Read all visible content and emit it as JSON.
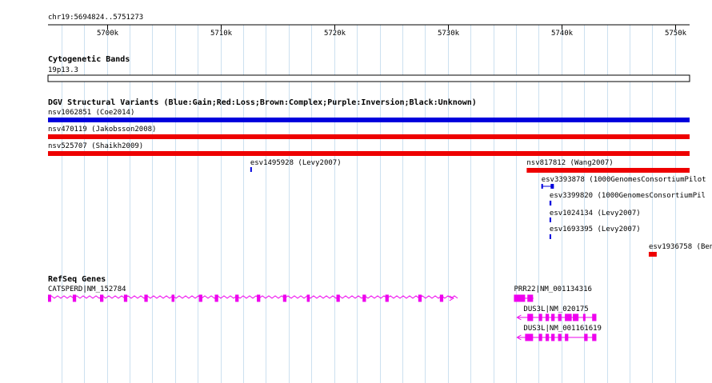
{
  "view": {
    "location": "chr19:5694824..5751273",
    "start": 5694824,
    "end": 5751273,
    "grid_color": "#cce0f0",
    "ticks": [
      {
        "pos": 5700000,
        "label": "5700k"
      },
      {
        "pos": 5710000,
        "label": "5710k"
      },
      {
        "pos": 5720000,
        "label": "5720k"
      },
      {
        "pos": 5730000,
        "label": "5730k"
      },
      {
        "pos": 5740000,
        "label": "5740k"
      },
      {
        "pos": 5750000,
        "label": "5750k"
      }
    ]
  },
  "tracks": {
    "cyto": {
      "title": "Cytogenetic Bands",
      "band": "19p13.3"
    },
    "dgv": {
      "title": "DGV Structural Variants (Blue:Gain;Red:Loss;Brown:Complex;Purple:Inversion;Black:Unknown)",
      "colors": {
        "gain": "#0000dd",
        "loss": "#ee0000"
      },
      "features": [
        {
          "label": "nsv1062851 (Coe2014)",
          "start": 5694824,
          "end": 5751273,
          "type": "gain"
        },
        {
          "label": "nsv470119 (Jakobsson2008)",
          "start": 5694824,
          "end": 5751273,
          "type": "loss"
        },
        {
          "label": "nsv525707 (Shaikh2009)",
          "start": 5694824,
          "end": 5751273,
          "type": "loss"
        },
        {
          "label": "esv1495928 (Levy2007)",
          "start": 5712620,
          "end": 5712700,
          "type": "gain"
        },
        {
          "label": "nsv817812 (Wang2007)",
          "start": 5736940,
          "end": 5751273,
          "type": "loss"
        },
        {
          "label": "esv3393878 (1000GenomesConsortiumPilot",
          "start": 5738230,
          "end": 5739330,
          "type": "gain"
        },
        {
          "label": "esv3399820 (1000GenomesConsortiumPil",
          "start": 5738950,
          "end": 5739110,
          "type": "gain"
        },
        {
          "label": "esv1024134 (Levy2007)",
          "start": 5738950,
          "end": 5739030,
          "type": "gain"
        },
        {
          "label": "esv1693395 (Levy2007)",
          "start": 5738950,
          "end": 5739030,
          "type": "gain"
        },
        {
          "label": "esv1936758 (Ben",
          "start": 5747680,
          "end": 5748380,
          "type": "loss"
        }
      ]
    },
    "refseq": {
      "title": "RefSeq Genes",
      "color": "#ee00ee",
      "genes": [
        {
          "label": "CATSPERD|NM_152784",
          "start": 5694824,
          "end": 5730500,
          "strand": "+",
          "exons": [
            [
              5694824,
              5695100
            ],
            [
              5697000,
              5697300
            ],
            [
              5699400,
              5699700
            ],
            [
              5701500,
              5701800
            ],
            [
              5703300,
              5703600
            ],
            [
              5705700,
              5705950
            ],
            [
              5708100,
              5708400
            ],
            [
              5709500,
              5709800
            ],
            [
              5711300,
              5711600
            ],
            [
              5713200,
              5713500
            ],
            [
              5715500,
              5715800
            ],
            [
              5717600,
              5717850
            ],
            [
              5720200,
              5720500
            ],
            [
              5722500,
              5722800
            ],
            [
              5724500,
              5724800
            ],
            [
              5727400,
              5727700
            ],
            [
              5729300,
              5729600
            ]
          ]
        },
        {
          "label": "PRR22|NM_001134316",
          "start": 5735820,
          "end": 5737500,
          "strand": "+",
          "exons": [
            [
              5735820,
              5736800
            ],
            [
              5737000,
              5737500
            ]
          ]
        },
        {
          "label": "DUS3L|NM_020175",
          "start": 5736100,
          "end": 5743070,
          "strand": "-",
          "exons": [
            [
              5737000,
              5737500
            ],
            [
              5738000,
              5738300
            ],
            [
              5738600,
              5738900
            ],
            [
              5739100,
              5739400
            ],
            [
              5739700,
              5740000
            ],
            [
              5740300,
              5740900
            ],
            [
              5741000,
              5741500
            ],
            [
              5741900,
              5742100
            ],
            [
              5742700,
              5743070
            ]
          ]
        },
        {
          "label": "DUS3L|NM_001161619",
          "start": 5736100,
          "end": 5743070,
          "strand": "-",
          "exons": [
            [
              5736800,
              5737500
            ],
            [
              5738000,
              5738300
            ],
            [
              5738600,
              5738900
            ],
            [
              5739100,
              5739400
            ],
            [
              5739700,
              5740000
            ],
            [
              5740300,
              5740600
            ],
            [
              5742000,
              5742300
            ],
            [
              5742700,
              5743070
            ]
          ]
        }
      ]
    }
  }
}
